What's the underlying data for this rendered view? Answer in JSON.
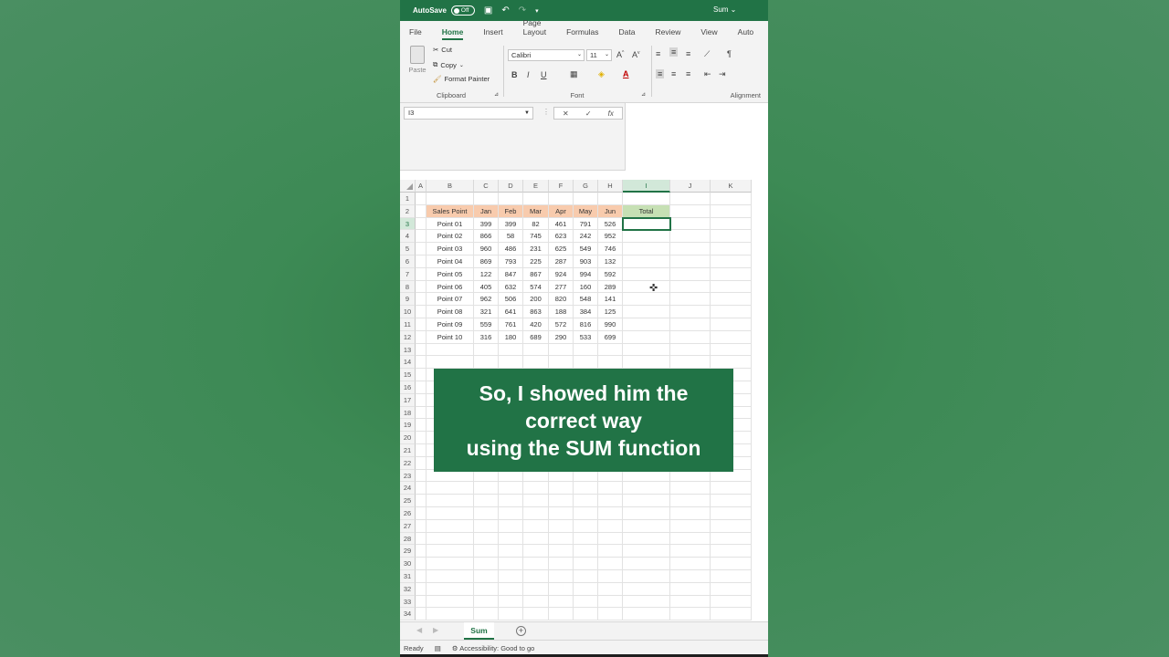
{
  "titlebar": {
    "autosave_label": "AutoSave",
    "toggle_state": "Off",
    "doc_name": "Sum ⌄"
  },
  "tabs": [
    "File",
    "Home",
    "Insert",
    "Page Layout",
    "Formulas",
    "Data",
    "Review",
    "View",
    "Auto"
  ],
  "active_tab": "Home",
  "ribbon": {
    "clipboard": {
      "paste_label": "Paste",
      "cut_label": "Cut",
      "copy_label": "Copy",
      "format_painter_label": "Format Painter",
      "group_label": "Clipboard"
    },
    "font": {
      "font_name": "Calibri",
      "font_size": "11",
      "group_label": "Font"
    },
    "alignment": {
      "group_label": "Alignment"
    }
  },
  "formula_bar": {
    "name_box": "I3",
    "fx_label": "fx"
  },
  "columns": [
    "A",
    "B",
    "C",
    "D",
    "E",
    "F",
    "G",
    "H",
    "I",
    "J",
    "K"
  ],
  "selected_column": "I",
  "rows": [
    "1",
    "2",
    "3",
    "4",
    "5",
    "6",
    "7",
    "8",
    "9",
    "10",
    "11",
    "12",
    "13",
    "14",
    "15",
    "16",
    "17",
    "18",
    "19",
    "20",
    "21",
    "22",
    "23",
    "24",
    "25",
    "26",
    "27",
    "28",
    "29",
    "30",
    "31",
    "32",
    "33",
    "34"
  ],
  "selected_row": "3",
  "table": {
    "headers": [
      "Sales Point",
      "Jan",
      "Feb",
      "Mar",
      "Apr",
      "May",
      "Jun",
      "Total"
    ],
    "data": [
      [
        "Point 01",
        "399",
        "399",
        "82",
        "461",
        "791",
        "526"
      ],
      [
        "Point 02",
        "866",
        "58",
        "745",
        "623",
        "242",
        "952"
      ],
      [
        "Point 03",
        "960",
        "486",
        "231",
        "625",
        "549",
        "746"
      ],
      [
        "Point 04",
        "869",
        "793",
        "225",
        "287",
        "903",
        "132"
      ],
      [
        "Point 05",
        "122",
        "847",
        "867",
        "924",
        "994",
        "592"
      ],
      [
        "Point 06",
        "405",
        "632",
        "574",
        "277",
        "160",
        "289"
      ],
      [
        "Point 07",
        "962",
        "506",
        "200",
        "820",
        "548",
        "141"
      ],
      [
        "Point 08",
        "321",
        "641",
        "863",
        "188",
        "384",
        "125"
      ],
      [
        "Point 09",
        "559",
        "761",
        "420",
        "572",
        "816",
        "990"
      ],
      [
        "Point 10",
        "316",
        "180",
        "689",
        "290",
        "533",
        "699"
      ]
    ]
  },
  "caption": {
    "line1": "So, I showed him the",
    "line2": "correct way",
    "line3": "using the SUM function"
  },
  "sheet_tab": "Sum",
  "status": {
    "ready": "Ready",
    "accessibility": "Accessibility: Good to go"
  },
  "colors": {
    "excel_green": "#217346",
    "header_orange": "#f8cbad",
    "header_green": "#c6e0b4"
  }
}
